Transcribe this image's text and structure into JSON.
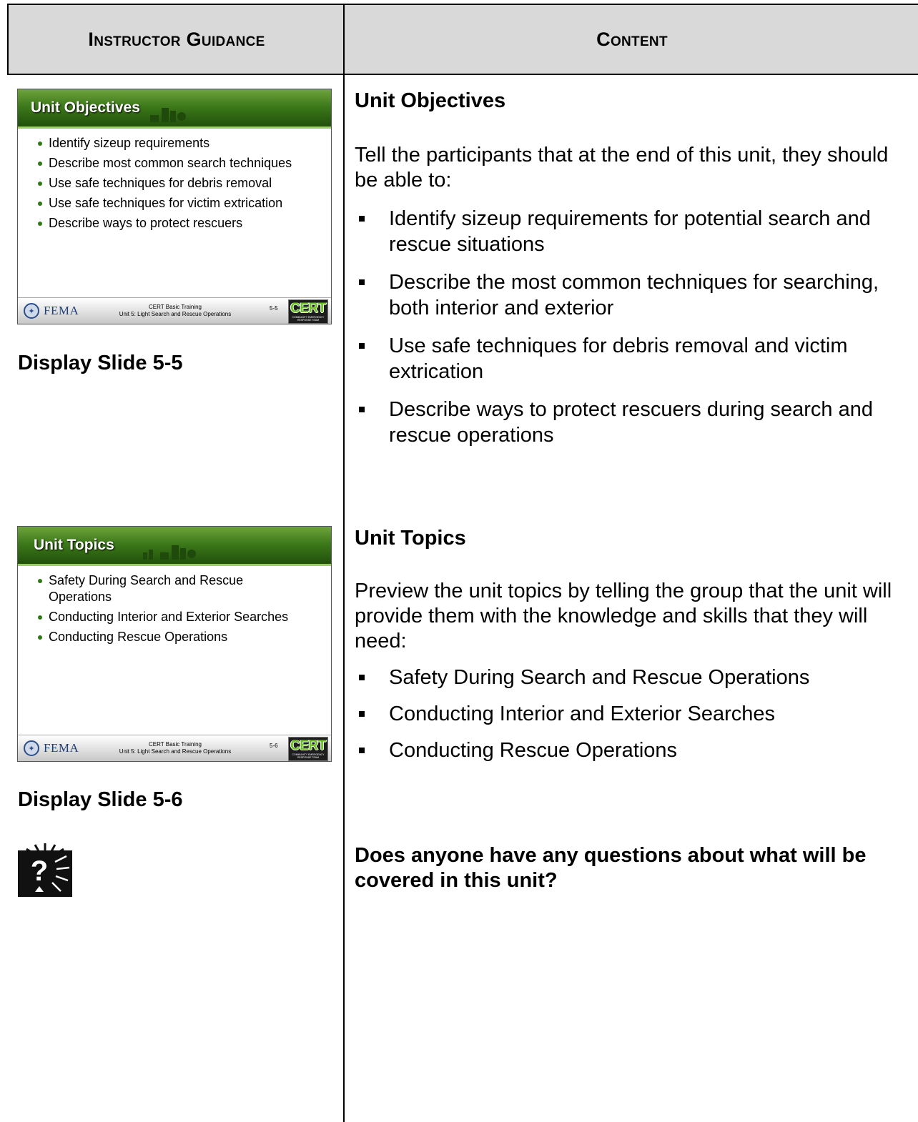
{
  "header": {
    "left": "Instructor Guidance",
    "right": "Content"
  },
  "slides": [
    {
      "title": "Unit Objectives",
      "bullets": [
        "Identify sizeup requirements",
        "Describe most common search techniques",
        "Use safe techniques for debris removal",
        "Use safe techniques for victim extrication",
        "Describe ways to protect rescuers"
      ],
      "footer_brand": "FEMA",
      "footer_line1": "CERT Basic Training",
      "footer_line2": "Unit 5: Light Search and Rescue Operations",
      "footer_number": "5-5",
      "footer_logo": "CERT",
      "footer_logo_sub": "COMMUNITY EMERGENCY RESPONSE TEAM",
      "display_label": "Display Slide 5-5"
    },
    {
      "title": "Unit Topics",
      "bullets": [
        "Safety During Search and Rescue Operations",
        "Conducting Interior and Exterior Searches",
        "Conducting Rescue Operations"
      ],
      "footer_brand": "FEMA",
      "footer_line1": "CERT Basic Training",
      "footer_line2": "Unit 5: Light Search and Rescue Operations",
      "footer_number": "5-6",
      "footer_logo": "CERT",
      "footer_logo_sub": "COMMUNITY EMERGENCY RESPONSE TEAM",
      "display_label": "Display Slide 5-6"
    }
  ],
  "content": {
    "objectives": {
      "heading": "Unit Objectives",
      "intro": "Tell the participants that at the end of this unit, they should be able to:",
      "bullets": [
        "Identify sizeup requirements for potential search and rescue situations",
        "Describe the most common techniques for searching, both interior and exterior",
        "Use safe techniques for debris removal and victim extrication",
        "Describe ways to protect rescuers during search and rescue operations"
      ]
    },
    "topics": {
      "heading": "Unit Topics",
      "intro": "Preview the unit topics by telling the group that the unit will provide them with the knowledge and skills that they will need:",
      "bullets": [
        "Safety During Search and Rescue Operations",
        "Conducting Interior and Exterior Searches",
        "Conducting Rescue Operations"
      ]
    },
    "question": "Does anyone have any questions about what will be covered in this unit?"
  },
  "icons": {
    "question_icon": "question-prompt-icon"
  }
}
